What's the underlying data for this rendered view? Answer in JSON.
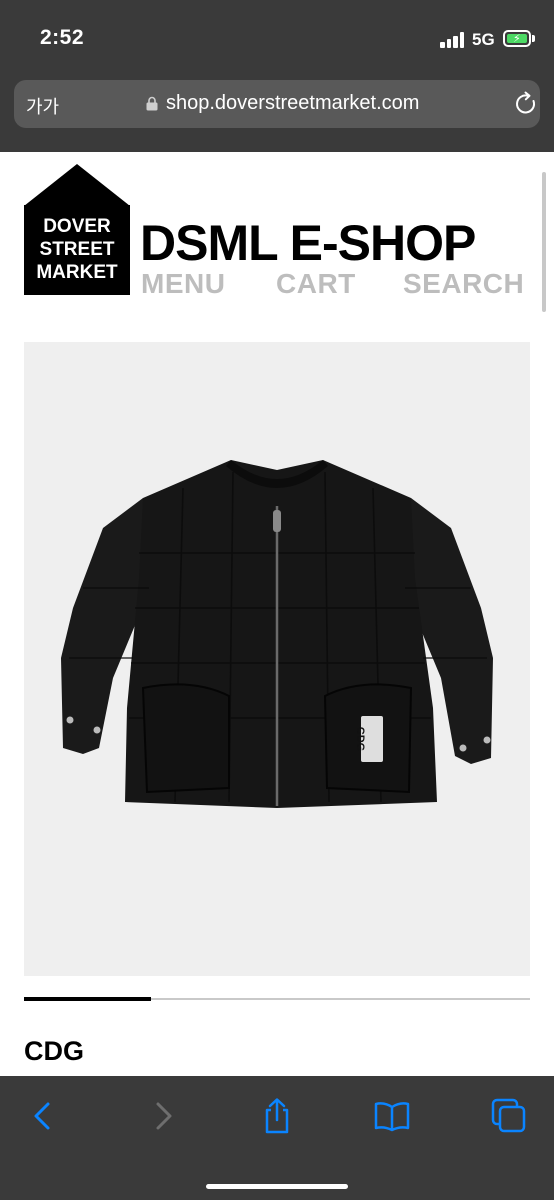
{
  "status_bar": {
    "time": "2:52",
    "network": "5G",
    "battery_level": 1.0,
    "battery_color": "#4cd964"
  },
  "browser": {
    "text_size_label": "가가",
    "url": "shop.doverstreetmarket.com",
    "icons": {
      "lock": "lock-icon",
      "reload": "reload-icon",
      "back": "back-icon",
      "forward": "forward-icon",
      "share": "share-icon",
      "bookmarks": "bookmarks-icon",
      "tabs": "tabs-icon"
    },
    "accent_color": "#0a84ff"
  },
  "site": {
    "logo": {
      "line1": "DOVER",
      "line2": "STREET",
      "line3": "MARKET"
    },
    "title": "DSML E-SHOP",
    "nav": {
      "menu": "MENU",
      "cart": "CART",
      "search": "SEARCH"
    }
  },
  "product": {
    "image_description_icon": "jacket-image",
    "gallery_progress": 0.25,
    "label_text": "CDG",
    "brand": "CDG"
  }
}
